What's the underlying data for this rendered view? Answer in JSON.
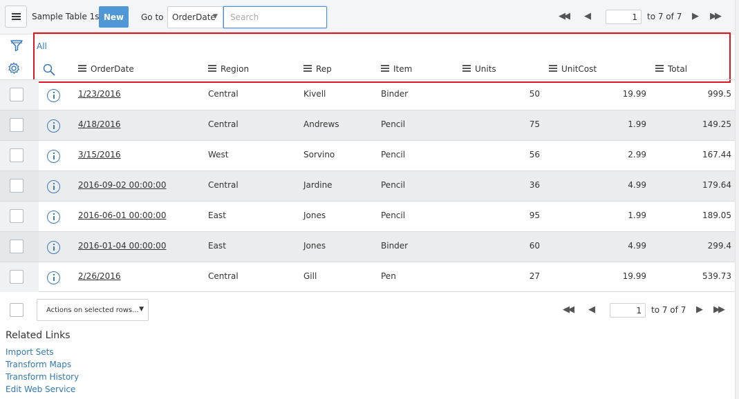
{
  "header": {
    "title": "Sample Table 1s",
    "new_label": "New",
    "goto_label": "Go to",
    "goto_selected": "OrderDate",
    "search_placeholder": "Search",
    "page_value": "1",
    "page_range": "to 7 of 7"
  },
  "list": {
    "breadcrumb": "All",
    "columns": [
      "OrderDate",
      "Region",
      "Rep",
      "Item",
      "Units",
      "UnitCost",
      "Total"
    ],
    "rows": [
      {
        "order_date": "1/23/2016",
        "region": "Central",
        "rep": "Kivell",
        "item": "Binder",
        "units": "50",
        "unit_cost": "19.99",
        "total": "999.5"
      },
      {
        "order_date": "4/18/2016",
        "region": "Central",
        "rep": "Andrews",
        "item": "Pencil",
        "units": "75",
        "unit_cost": "1.99",
        "total": "149.25"
      },
      {
        "order_date": "3/15/2016",
        "region": "West",
        "rep": "Sorvino",
        "item": "Pencil",
        "units": "56",
        "unit_cost": "2.99",
        "total": "167.44"
      },
      {
        "order_date": "2016-09-02 00:00:00",
        "region": "Central",
        "rep": "Jardine",
        "item": "Pencil",
        "units": "36",
        "unit_cost": "4.99",
        "total": "179.64"
      },
      {
        "order_date": "2016-06-01 00:00:00",
        "region": "East",
        "rep": "Jones",
        "item": "Pencil",
        "units": "95",
        "unit_cost": "1.99",
        "total": "189.05"
      },
      {
        "order_date": "2016-01-04 00:00:00",
        "region": "East",
        "rep": "Jones",
        "item": "Binder",
        "units": "60",
        "unit_cost": "4.99",
        "total": "299.4"
      },
      {
        "order_date": "2/26/2016",
        "region": "Central",
        "rep": "Gill",
        "item": "Pen",
        "units": "27",
        "unit_cost": "19.99",
        "total": "539.73"
      }
    ]
  },
  "footer": {
    "actions_label": "Actions on selected rows...",
    "page_value": "1",
    "page_range": "to 7 of 7"
  },
  "related": {
    "title": "Related Links",
    "links": [
      "Import Sets",
      "Transform Maps",
      "Transform History",
      "Edit Web Service"
    ]
  },
  "colors": {
    "accent": "#4f97d6",
    "link": "#2f79b8",
    "highlight": "#e0141e"
  },
  "icons": [
    "hamburger-icon",
    "funnel-icon",
    "gear-icon",
    "search-icon",
    "info-icon",
    "first-page-icon",
    "previous-page-icon",
    "next-page-icon",
    "last-page-icon",
    "list-menu-icon"
  ]
}
